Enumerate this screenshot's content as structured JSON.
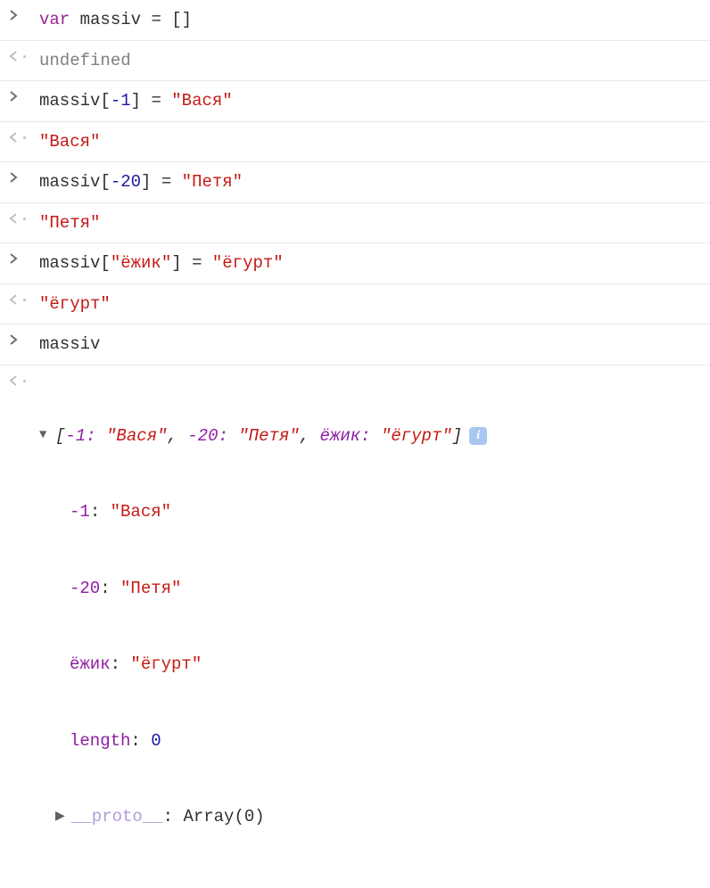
{
  "entries": [
    {
      "type": "input",
      "tokens": {
        "keyword": "var",
        "var": "massiv",
        "eq": "=",
        "brackets": "[]"
      }
    },
    {
      "type": "output",
      "undefined": "undefined"
    },
    {
      "type": "input",
      "tokens": {
        "var": "massiv",
        "open": "[",
        "idx": "-1",
        "close": "]",
        "eq": "=",
        "val": "\"Вася\""
      }
    },
    {
      "type": "output",
      "string": "\"Вася\""
    },
    {
      "type": "input",
      "tokens": {
        "var": "massiv",
        "open": "[",
        "idx": "-20",
        "close": "]",
        "eq": "=",
        "val": "\"Петя\""
      }
    },
    {
      "type": "output",
      "string": "\"Петя\""
    },
    {
      "type": "input",
      "tokens": {
        "var": "massiv",
        "open": "[",
        "key": "\"ёжик\"",
        "close": "]",
        "eq": "=",
        "val": "\"ёгурт\""
      }
    },
    {
      "type": "output",
      "string": "\"ёгурт\""
    },
    {
      "type": "input",
      "tokens": {
        "var": "massiv"
      }
    }
  ],
  "expanded": {
    "summary": {
      "open": "[",
      "k1": "-1:",
      "v1": "\"Вася\"",
      "c1": ",",
      "k2": "-20:",
      "v2": "\"Петя\"",
      "c2": ",",
      "k3": "ёжик:",
      "v3": "\"ёгурт\"",
      "close": "]"
    },
    "props": [
      {
        "key": "-1",
        "val": "\"Вася\""
      },
      {
        "key": "-20",
        "val": "\"Петя\""
      },
      {
        "key": "ёжик",
        "val": "\"ёгурт\""
      }
    ],
    "length": {
      "key": "length",
      "val": "0"
    },
    "proto": {
      "key": "__proto__",
      "val": "Array(0)"
    }
  },
  "icons": {
    "info": "i"
  }
}
